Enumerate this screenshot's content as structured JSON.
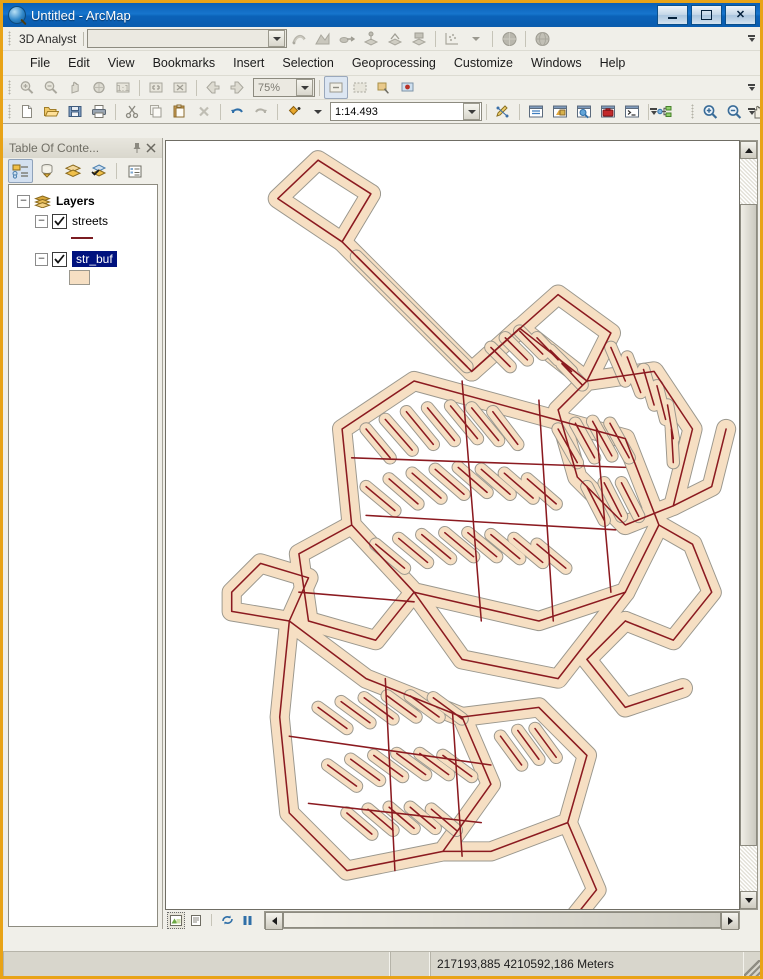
{
  "window": {
    "title": "Untitled - ArcMap",
    "app_icon": "arcmap-globe-icon",
    "minimize_label": "_",
    "maximize_label": "□",
    "close_label": "✕"
  },
  "analyst_toolbar": {
    "name": "3D Analyst",
    "menu_label": "3D Analyst",
    "layer_combo_value": "",
    "buttons": [
      {
        "name": "interpolate-line-icon",
        "enabled": false
      },
      {
        "name": "steepest-path-icon",
        "enabled": false
      },
      {
        "name": "line-of-sight-icon",
        "enabled": false
      },
      {
        "name": "create-profile-graph-icon",
        "enabled": false
      },
      {
        "name": "create-steepest-path-icon",
        "enabled": false
      },
      {
        "name": "surface-icon",
        "enabled": false
      },
      {
        "name": "point-set-icon",
        "enabled": false
      },
      {
        "name": "arcscene-icon",
        "enabled": false
      },
      {
        "name": "arcglobe-icon",
        "enabled": false
      }
    ]
  },
  "menu": {
    "items": [
      "File",
      "Edit",
      "View",
      "Bookmarks",
      "Insert",
      "Selection",
      "Geoprocessing",
      "Customize",
      "Windows",
      "Help"
    ]
  },
  "tools_toolbar": {
    "zoom_value": "75%",
    "buttons": [
      {
        "name": "zoom-in-icon"
      },
      {
        "name": "zoom-out-icon"
      },
      {
        "name": "pan-icon"
      },
      {
        "name": "full-extent-icon"
      },
      {
        "name": "fixed-zoom-in-icon"
      },
      {
        "name": "zoom-to-selection-icon"
      },
      {
        "name": "zoom-to-layer-icon"
      },
      {
        "name": "previous-extent-icon"
      },
      {
        "name": "next-extent-icon"
      },
      {
        "name": "select-features-icon"
      },
      {
        "name": "clear-selection-icon"
      },
      {
        "name": "select-elements-icon"
      },
      {
        "name": "identify-icon"
      }
    ]
  },
  "standard_toolbar": {
    "scale_value": "1:14.493",
    "editor_combo_value": "",
    "buttons": [
      {
        "name": "new-map-icon"
      },
      {
        "name": "open-icon"
      },
      {
        "name": "save-icon"
      },
      {
        "name": "print-icon"
      },
      {
        "name": "cut-icon"
      },
      {
        "name": "copy-icon"
      },
      {
        "name": "paste-icon"
      },
      {
        "name": "delete-icon"
      },
      {
        "name": "undo-icon"
      },
      {
        "name": "redo-icon"
      },
      {
        "name": "add-data-icon"
      }
    ],
    "right_buttons": [
      {
        "name": "editor-toolbar-icon"
      },
      {
        "name": "table-of-contents-icon"
      },
      {
        "name": "catalog-window-icon"
      },
      {
        "name": "search-window-icon"
      },
      {
        "name": "arctoolbox-icon"
      },
      {
        "name": "python-window-icon"
      },
      {
        "name": "model-builder-icon"
      }
    ],
    "far_buttons": [
      {
        "name": "zoom-in-icon"
      },
      {
        "name": "zoom-out-icon"
      },
      {
        "name": "pan-icon"
      },
      {
        "name": "globe-icon"
      }
    ]
  },
  "toc": {
    "title": "Table Of Conte...",
    "pin_icon": "pin-icon",
    "close_icon": "close-icon",
    "tools": [
      {
        "name": "list-by-drawing-order-icon",
        "active": true
      },
      {
        "name": "list-by-source-icon",
        "active": false
      },
      {
        "name": "list-by-visibility-icon",
        "active": false
      },
      {
        "name": "list-by-selection-icon",
        "active": false
      },
      {
        "name": "toc-options-icon",
        "active": false
      }
    ],
    "tree": {
      "root_label": "Layers",
      "root_expander": "−",
      "layers": [
        {
          "label": "streets",
          "checked": true,
          "expander": "−",
          "selected": false,
          "symbol": "line",
          "symbol_color": "#7b1c21"
        },
        {
          "label": "str_buf",
          "checked": true,
          "expander": "−",
          "selected": true,
          "symbol": "polygon",
          "symbol_color": "#f6dfc3"
        }
      ]
    }
  },
  "map": {
    "background": "#ffffff",
    "buffer_fill": "#f6dfc3",
    "buffer_outline": "#9a978d",
    "street_color": "#8b1a20",
    "view_buttons": [
      {
        "name": "data-view-button",
        "active": true
      },
      {
        "name": "layout-view-button",
        "active": false
      },
      {
        "name": "refresh-view-button",
        "active": false
      },
      {
        "name": "pause-drawing-button",
        "active": false
      }
    ]
  },
  "status_bar": {
    "left_text": "",
    "coordinates": "217193,885  4210592,186 Meters"
  }
}
